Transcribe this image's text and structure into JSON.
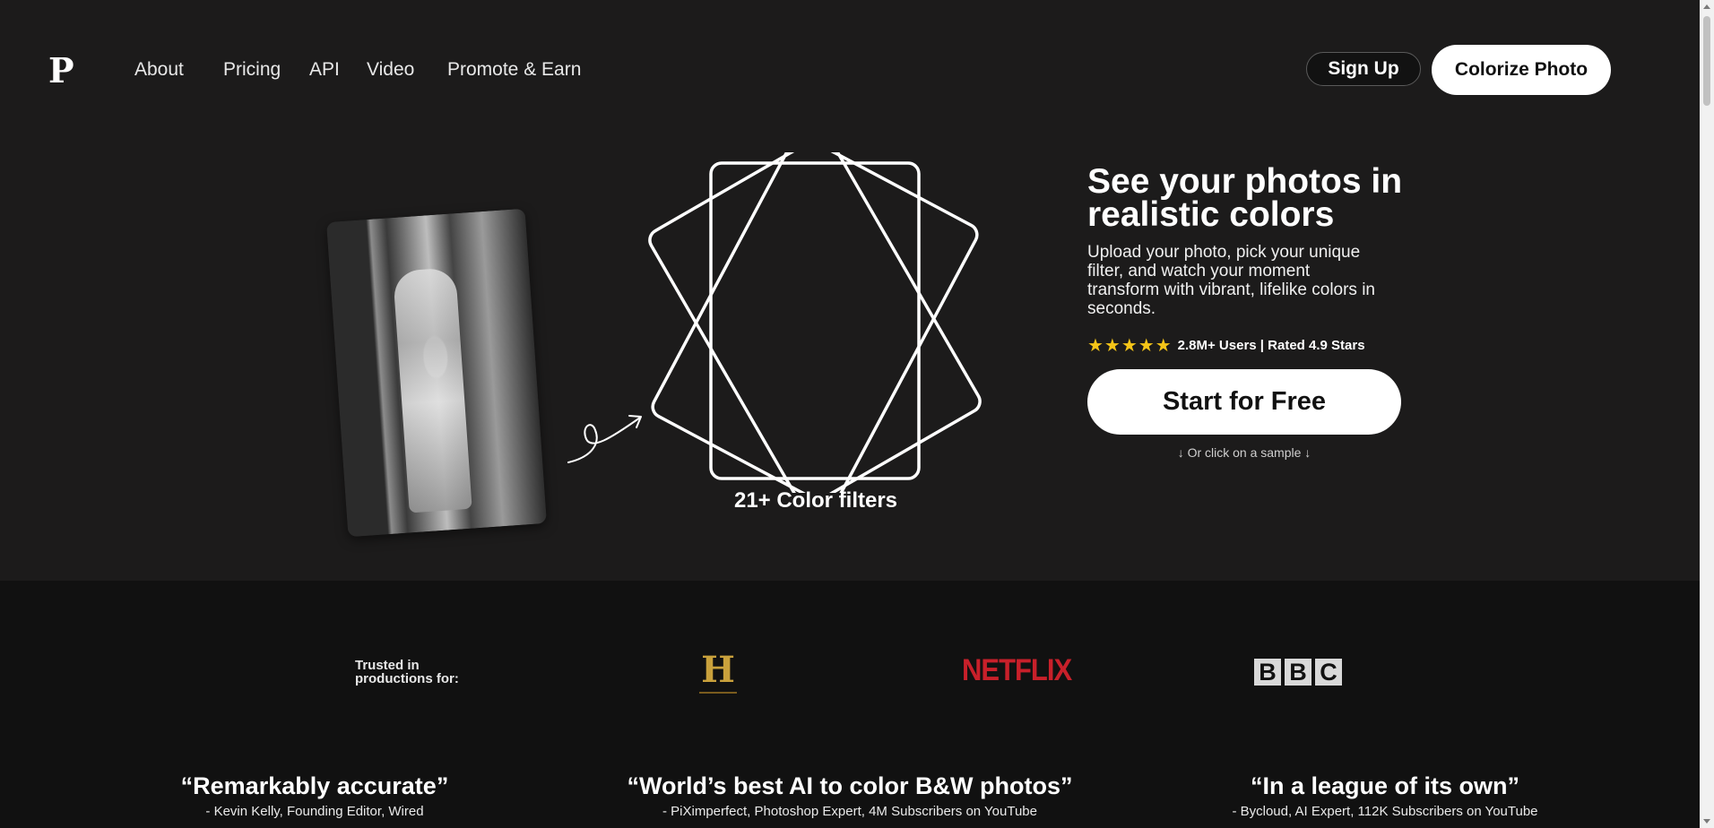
{
  "header": {
    "logo": "P",
    "nav": [
      "About",
      "Pricing",
      "API",
      "Video",
      "Promote & Earn"
    ],
    "signup_label": "Sign Up",
    "colorize_label": "Colorize Photo"
  },
  "hero": {
    "title_line1": "See your photos in",
    "title_line2": "realistic colors",
    "description": "Upload your photo, pick your unique filter, and watch your moment transform with vibrant, lifelike colors in seconds.",
    "rating_stars": "★★★★★",
    "rating_text": "2.8M+ Users | Rated 4.9 Stars",
    "start_label": "Start for Free",
    "sample_hint": "↓ Or click on a sample ↓",
    "filters_label": "21+ Color filters"
  },
  "trusted": {
    "label": "Trusted in productions for:",
    "history_logo": "H",
    "netflix_logo": "NETFLIX",
    "bbc_letters": [
      "B",
      "B",
      "C"
    ]
  },
  "quotes": [
    {
      "text": "“Remarkably accurate”",
      "author": "- Kevin Kelly, Founding Editor, Wired"
    },
    {
      "text": "“World’s best AI to color B&W photos”",
      "author": "- PiXimperfect, Photoshop Expert, 4M Subscribers on YouTube"
    },
    {
      "text": "“In a league of its own”",
      "author": "- Bycloud, AI Expert, 112K Subscribers on YouTube"
    }
  ],
  "colors": {
    "background": "#1c1b1b",
    "band": "#111111",
    "star": "#f5c518",
    "netflix": "#c8202a",
    "history": "#c9a13c"
  }
}
